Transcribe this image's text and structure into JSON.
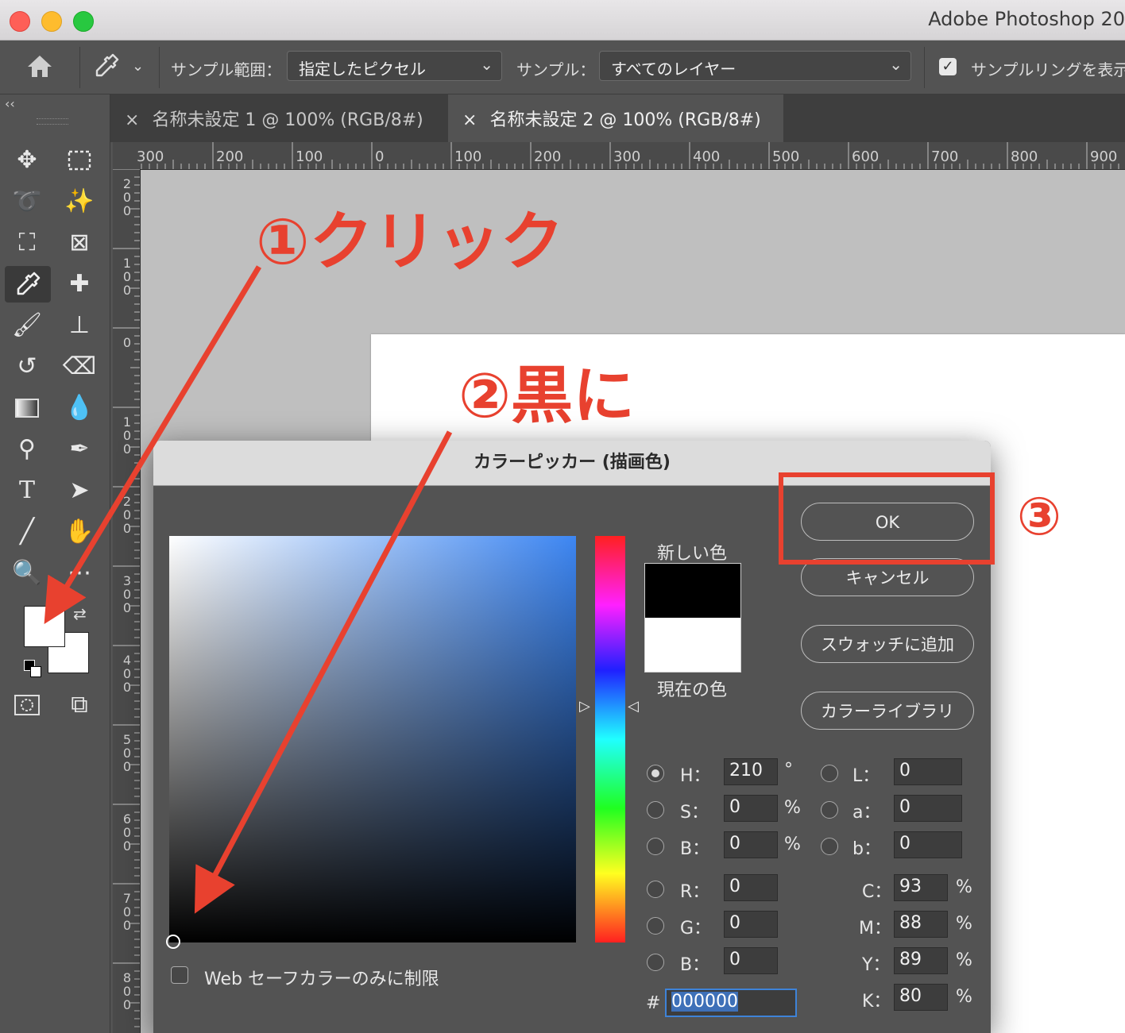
{
  "app": {
    "title": "Adobe Photoshop 20"
  },
  "options_bar": {
    "sample_size_label": "サンプル範囲：",
    "sample_size_value": "指定したピクセル",
    "sample_label": "サンプル：",
    "sample_value": "すべてのレイヤー",
    "show_ring_label": "サンプルリングを表示"
  },
  "tabs": [
    {
      "label": "名称未設定 1 @ 100% (RGB/8#)",
      "active": false
    },
    {
      "label": "名称未設定 2 @ 100% (RGB/8#)",
      "active": true
    }
  ],
  "tab_close_glyph": "×",
  "ruler": {
    "horizontal": [
      "300",
      "200",
      "100",
      "0",
      "100",
      "200",
      "300",
      "400",
      "500",
      "600",
      "700",
      "800",
      "900"
    ],
    "vertical": [
      "200",
      "100",
      "0",
      "100",
      "200",
      "300",
      "400",
      "500",
      "600",
      "700",
      "800"
    ]
  },
  "annotations": {
    "step1": "①クリック",
    "step2": "②黒に",
    "step3": "③",
    "color": "#e8412f"
  },
  "dialog": {
    "title": "カラーピッカー (描画色)",
    "ok": "OK",
    "cancel": "キャンセル",
    "add_swatch": "スウォッチに追加",
    "color_library": "カラーライブラリ",
    "new_color_label": "新しい色",
    "current_color_label": "現在の色",
    "new_color": "#000000",
    "current_color": "#ffffff",
    "hsb": [
      {
        "label": "H：",
        "value": "210",
        "unit": "°",
        "selected": true
      },
      {
        "label": "S：",
        "value": "0",
        "unit": "%",
        "selected": false
      },
      {
        "label": "B：",
        "value": "0",
        "unit": "%",
        "selected": false
      }
    ],
    "lab": [
      {
        "label": "L：",
        "value": "0"
      },
      {
        "label": "a：",
        "value": "0"
      },
      {
        "label": "b：",
        "value": "0"
      }
    ],
    "rgb": [
      {
        "label": "R：",
        "value": "0"
      },
      {
        "label": "G：",
        "value": "0"
      },
      {
        "label": "B：",
        "value": "0"
      }
    ],
    "cmyk": [
      {
        "label": "C：",
        "value": "93",
        "unit": "%"
      },
      {
        "label": "M：",
        "value": "88",
        "unit": "%"
      },
      {
        "label": "Y：",
        "value": "89",
        "unit": "%"
      },
      {
        "label": "K：",
        "value": "80",
        "unit": "%"
      }
    ],
    "hex_prefix": "#",
    "hex": "000000",
    "web_safe_label": "Web セーフカラーのみに制限"
  }
}
